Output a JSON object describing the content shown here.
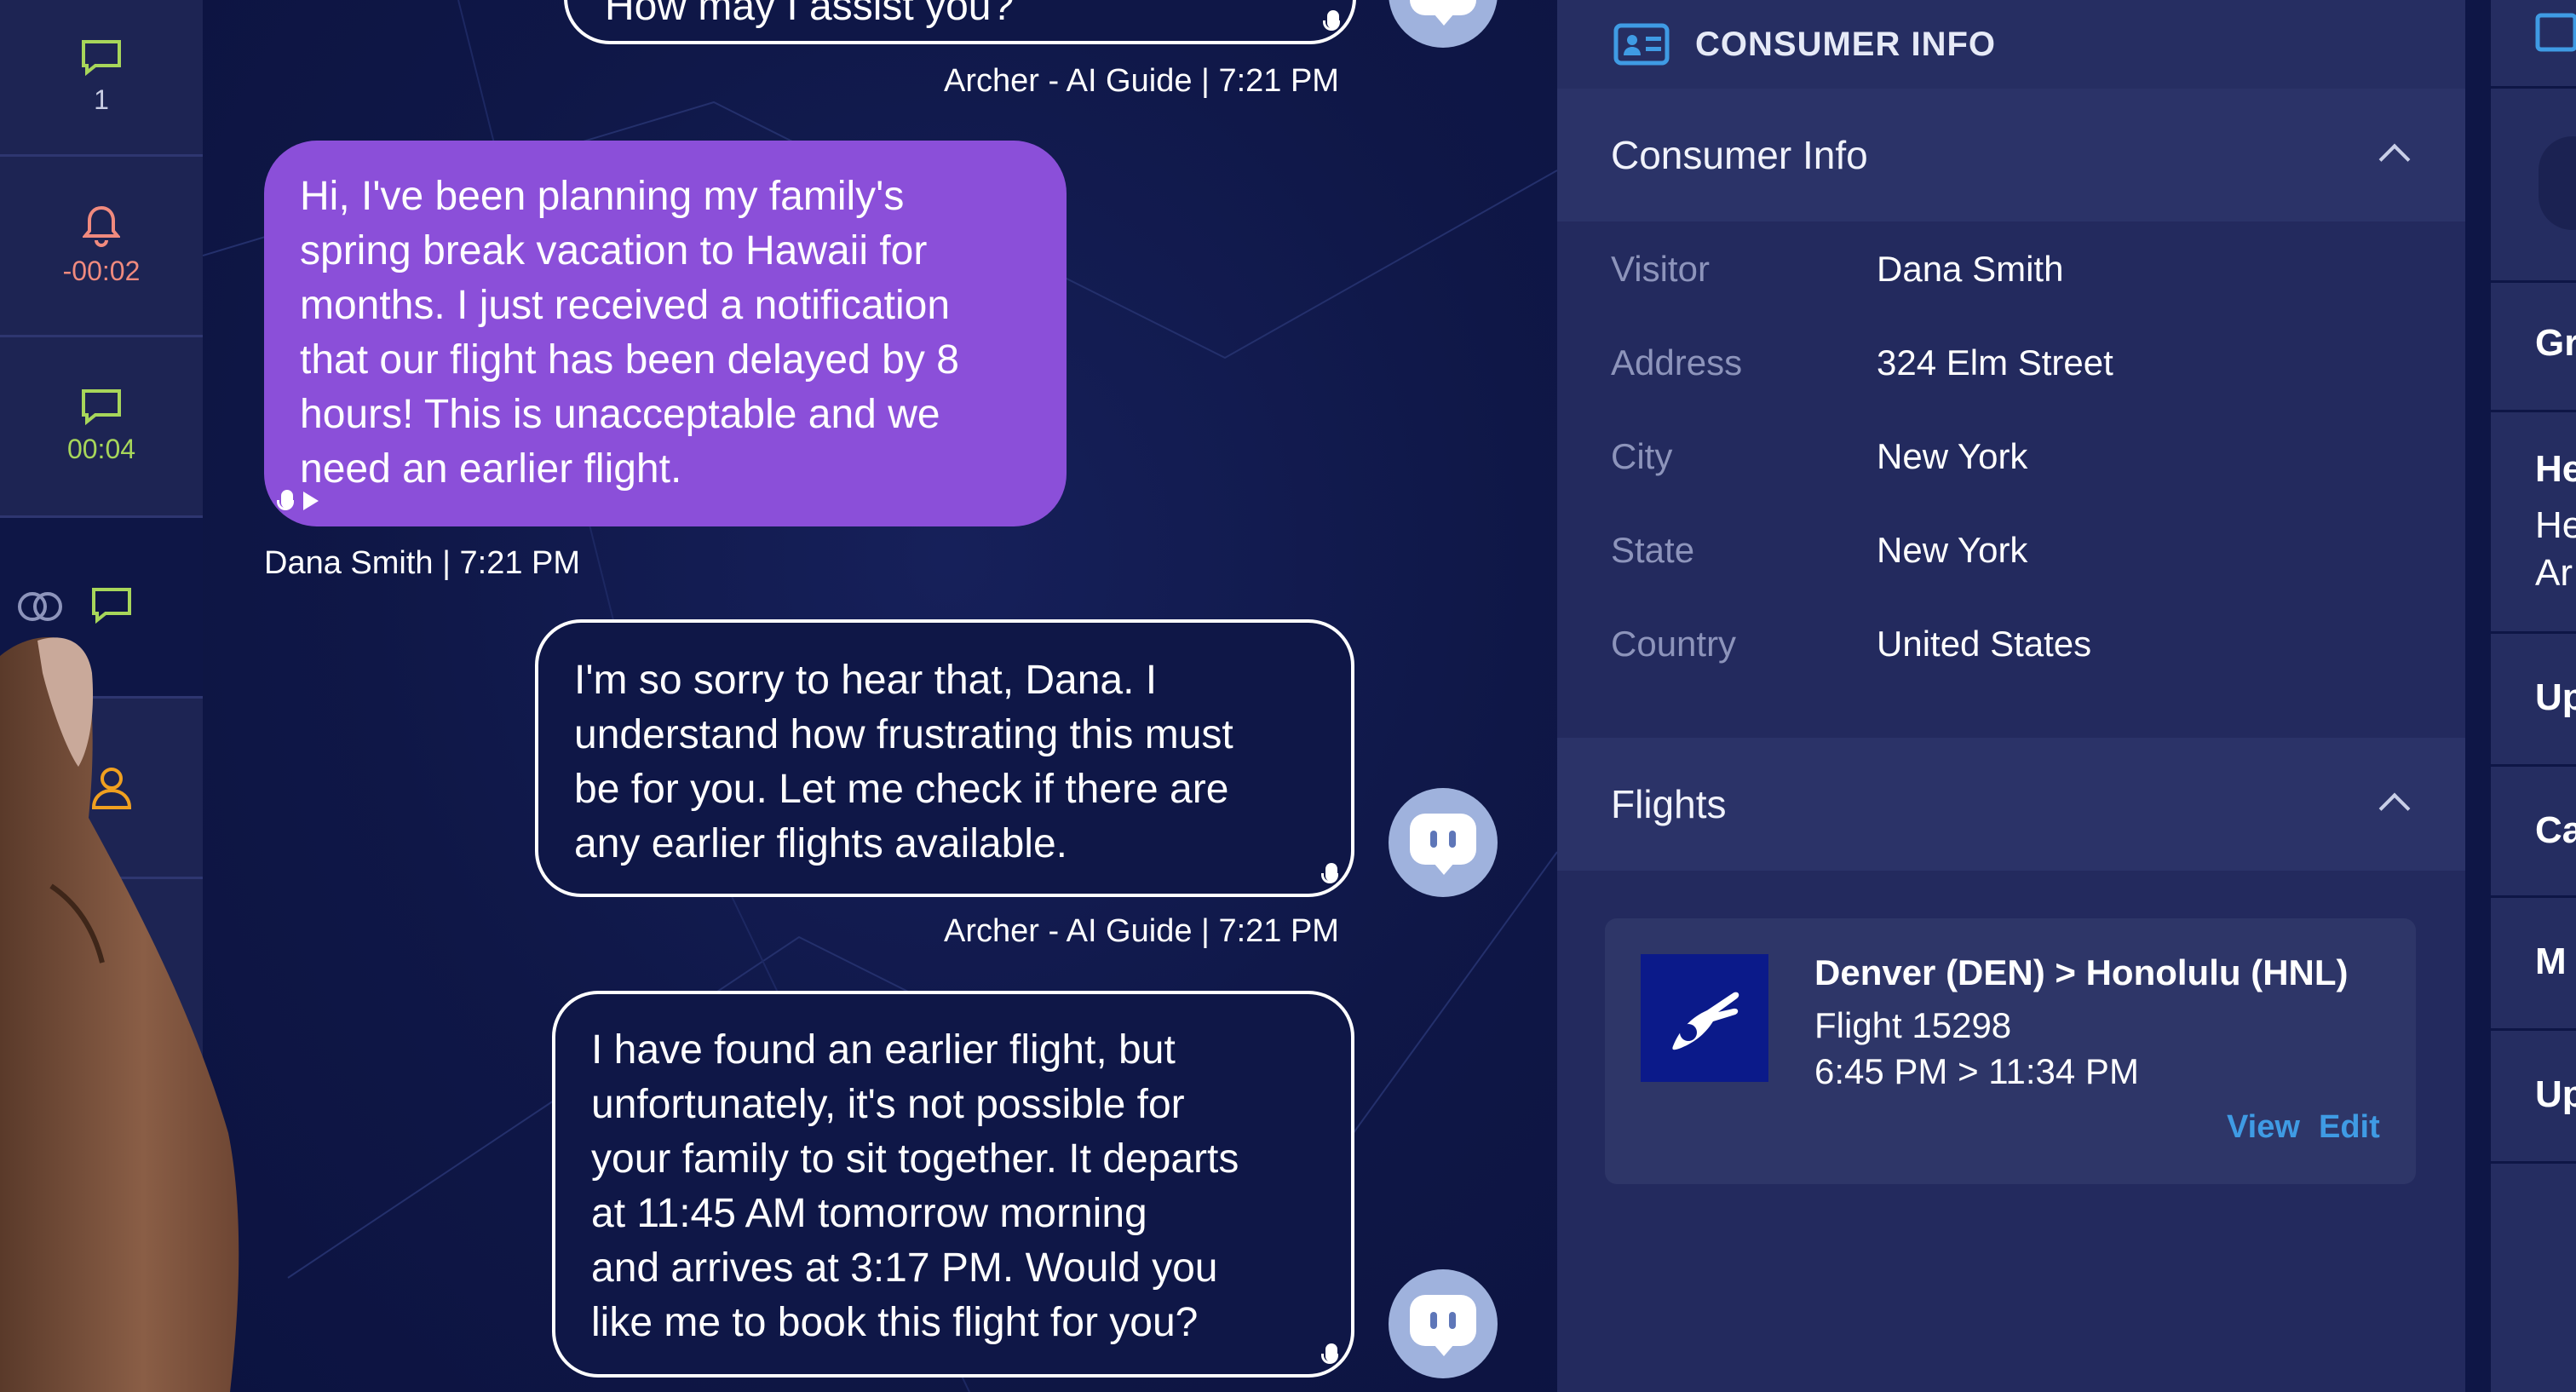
{
  "rail": {
    "items": [
      {
        "icon": "chat-bubble-icon",
        "label": "1",
        "color": "#a7d65a"
      },
      {
        "icon": "bell-icon",
        "label": "-00:02",
        "color": "#f08a7e"
      },
      {
        "icon": "chat-bubble-icon",
        "label": "00:04",
        "color": "#a7d65a"
      },
      {
        "icon": "chat-bubble-icon",
        "label": "",
        "color": "#a7d65a"
      },
      {
        "icon": "user-icon",
        "label": "",
        "color": "#f0a020"
      }
    ]
  },
  "chat": {
    "messages": [
      {
        "from": "agent",
        "text": "How may I assist you?",
        "meta": "Archer - AI Guide  |  7:21 PM"
      },
      {
        "from": "user",
        "lines": [
          "Hi, I've been planning my family's",
          "spring break vacation to Hawaii for",
          "months. I just received a notification",
          "that our flight has been delayed by 8",
          "hours! This is unacceptable and we",
          "need an earlier flight."
        ],
        "meta": "Dana Smith  |  7:21 PM"
      },
      {
        "from": "agent",
        "lines": [
          "I'm so sorry to hear that, Dana. I",
          "understand how frustrating this must",
          "be for you. Let me check if there are",
          "any earlier flights available."
        ],
        "meta": "Archer - AI Guide  |  7:21 PM"
      },
      {
        "from": "agent",
        "lines": [
          "I have found an earlier flight, but",
          "unfortunately, it's not possible for",
          "your family to sit together. It departs",
          "at 11:45 AM tomorrow morning",
          "and arrives at 3:17 PM. Would you",
          "like me to book this flight for you?"
        ]
      }
    ]
  },
  "info": {
    "header_title": "CONSUMER INFO",
    "consumer_section_title": "Consumer Info",
    "fields": [
      {
        "label": "Visitor",
        "value": "Dana Smith"
      },
      {
        "label": "Address",
        "value": "324 Elm Street"
      },
      {
        "label": "City",
        "value": "New York"
      },
      {
        "label": "State",
        "value": "New York"
      },
      {
        "label": "Country",
        "value": "United States"
      }
    ],
    "flights_section_title": "Flights",
    "flight": {
      "route": "Denver (DEN) > Honolulu (HNL)",
      "number": "Flight 15298",
      "times": "6:45 PM > 11:34 PM",
      "view_label": "View",
      "edit_label": "Edit"
    }
  },
  "strip": {
    "items": [
      "Gr",
      "He",
      "He",
      "Ar",
      "Up",
      "Ca",
      "M",
      "Up"
    ]
  },
  "colors": {
    "user_bubble": "#8b4fd9",
    "link": "#3f9be4",
    "accent_green": "#a7d65a"
  }
}
